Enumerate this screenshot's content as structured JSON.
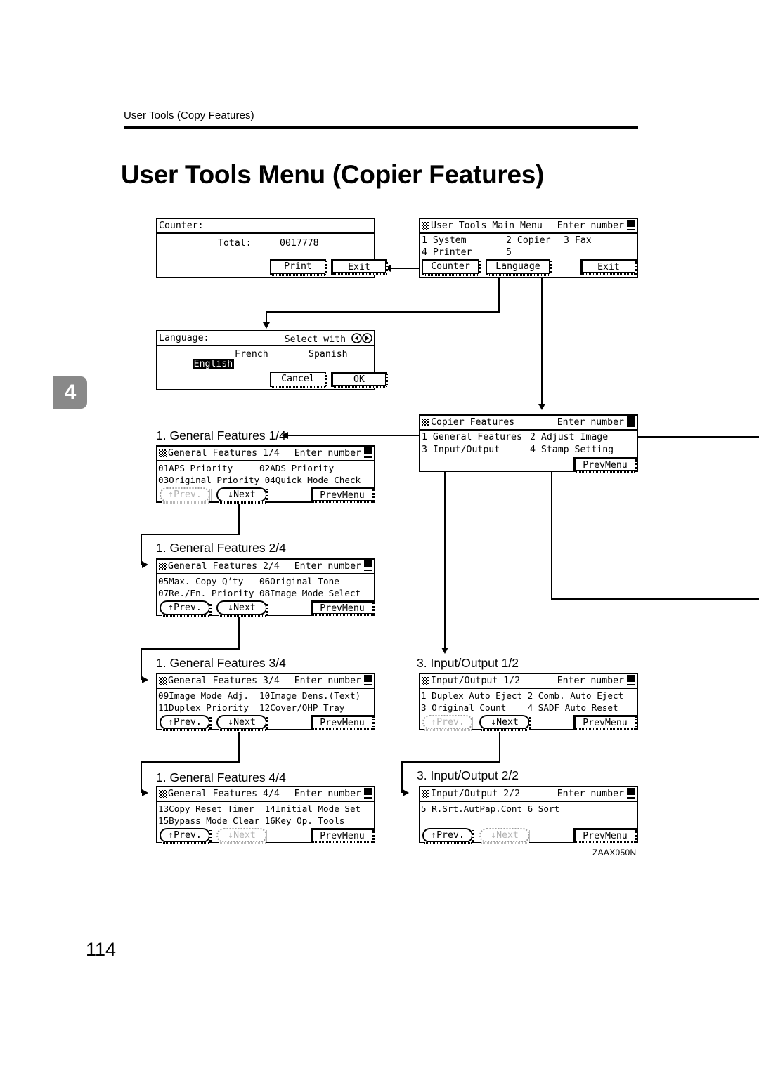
{
  "page": {
    "running_head": "User Tools (Copy Features)",
    "title": "User Tools Menu (Copier Features)",
    "chapter_tab": "4",
    "page_number": "114",
    "figure_id": "ZAAX050N"
  },
  "panels": {
    "counter": {
      "title": "Counter:",
      "label_total": "Total:",
      "value_total": "0017778",
      "btn_print": "Print",
      "btn_exit": "Exit"
    },
    "main_menu": {
      "title": "User Tools Main Menu",
      "hint": "Enter number",
      "item1": "1 System",
      "item2": "2 Copier",
      "item3": "3 Fax",
      "item4": "4 Printer",
      "item5": "5",
      "btn_counter": "Counter",
      "btn_language": "Language",
      "btn_exit": "Exit"
    },
    "language": {
      "title": "Language:",
      "hint": "Select with",
      "opt_english": "English",
      "opt_french": "French",
      "opt_spanish": "Spanish",
      "btn_cancel": "Cancel",
      "btn_ok": "OK"
    },
    "copier_features": {
      "title": "Copier Features",
      "hint": "Enter number",
      "item1": "1 General Features",
      "item2": "2 Adjust Image",
      "item3": "3 Input/Output",
      "item4": "4 Stamp Setting",
      "btn_prevmenu": "PrevMenu"
    },
    "gf1": {
      "caption": "1. General Features 1/4",
      "title": "General Features 1/4",
      "hint": "Enter number",
      "line1": "01APS Priority     02ADS Priority",
      "line2": "03Original Priority 04Quick Mode Check",
      "btn_prev": "↑Prev.",
      "btn_next": "↓Next",
      "btn_prevmenu": "PrevMenu"
    },
    "gf2": {
      "caption": "1. General Features 2/4",
      "title": "General Features 2/4",
      "hint": "Enter number",
      "line1": "05Max. Copy Q’ty   06Original Tone",
      "line2": "07Re./En. Priority 08Image Mode Select",
      "btn_prev": "↑Prev.",
      "btn_next": "↓Next",
      "btn_prevmenu": "PrevMenu"
    },
    "gf3": {
      "caption": "1. General Features 3/4",
      "title": "General Features 3/4",
      "hint": "Enter number",
      "line1": "09Image Mode Adj.  10Image Dens.(Text)",
      "line2": "11Duplex Priority  12Cover/OHP Tray",
      "btn_prev": "↑Prev.",
      "btn_next": "↓Next",
      "btn_prevmenu": "PrevMenu"
    },
    "gf4": {
      "caption": "1. General Features 4/4",
      "title": "General Features 4/4",
      "hint": "Enter number",
      "line1": "13Copy Reset Timer  14Initial Mode Set",
      "line2": "15Bypass Mode Clear 16Key Op. Tools",
      "btn_prev": "↑Prev.",
      "btn_next": "↓Next",
      "btn_prevmenu": "PrevMenu"
    },
    "io1": {
      "caption": "3. Input/Output 1/2",
      "title": "Input/Output 1/2",
      "hint": "Enter number",
      "line1": "1 Duplex Auto Eject 2 Comb. Auto Eject",
      "line2": "3 Original Count    4 SADF Auto Reset",
      "btn_prev": "↑Prev.",
      "btn_next": "↓Next",
      "btn_prevmenu": "PrevMenu"
    },
    "io2": {
      "caption": "3. Input/Output 2/2",
      "title": "Input/Output 2/2",
      "hint": "Enter number",
      "line1": "5 R.Srt.AutPap.Cont 6 Sort",
      "line2": "",
      "btn_prev": "↑Prev.",
      "btn_next": "↓Next",
      "btn_prevmenu": "PrevMenu"
    }
  }
}
